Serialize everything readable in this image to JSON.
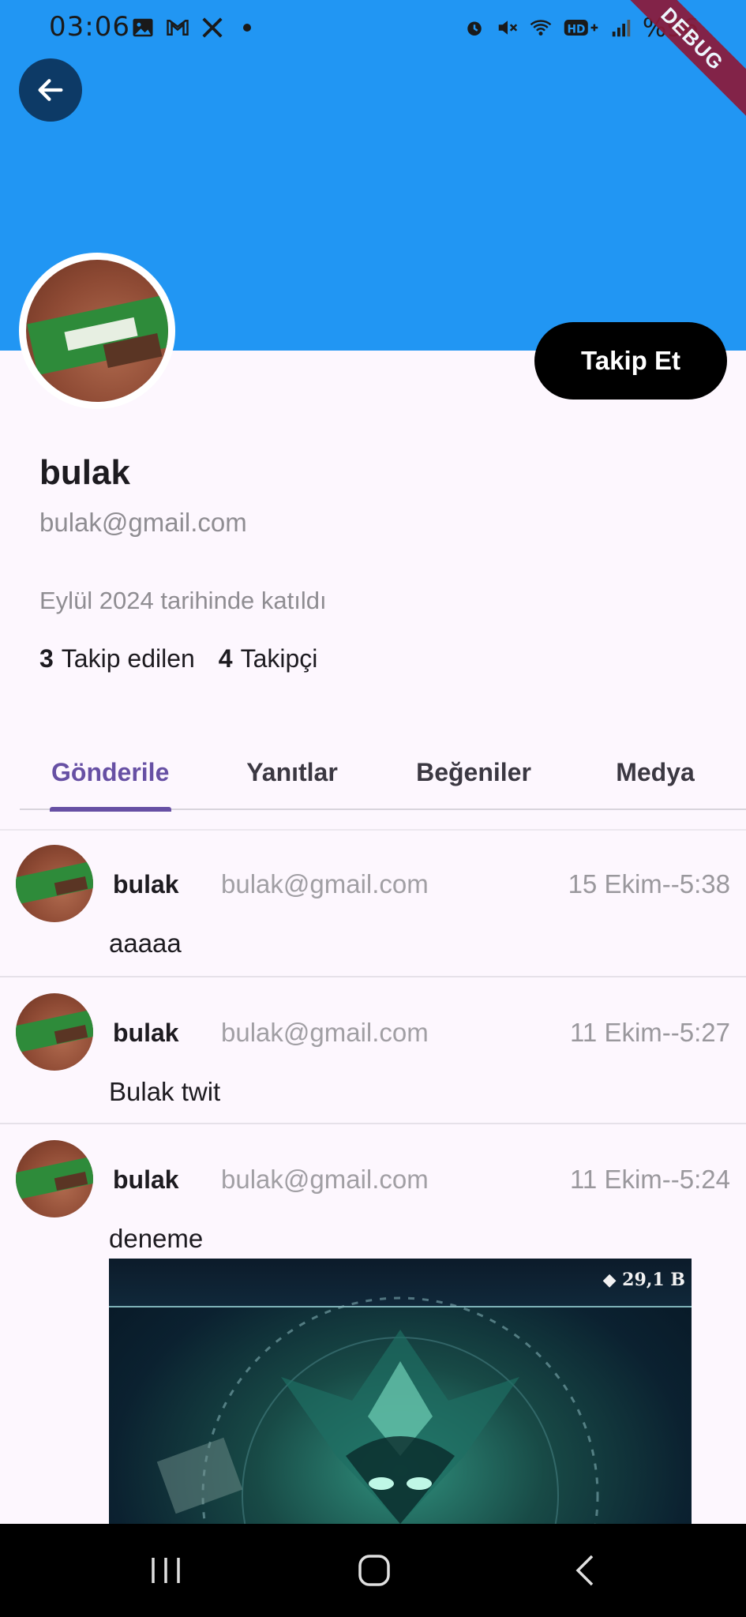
{
  "status_bar": {
    "time": "03:06",
    "left_icons": [
      "gallery-icon",
      "gmail-icon",
      "x-icon",
      "dot-icon"
    ],
    "right_icons": [
      "alarm-icon",
      "mute-icon",
      "wifi-icon",
      "hd-plus-icon",
      "signal-icon"
    ],
    "battery": "%96",
    "debug_banner": "DEBUG"
  },
  "header": {
    "back_label": "back",
    "banner_color": "#2196f3"
  },
  "profile": {
    "name": "bulak",
    "email": "bulak@gmail.com",
    "joined": "Eylül 2024 tarihinde katıldı",
    "following_count": "3",
    "following_label": "Takip edilen",
    "followers_count": "4",
    "followers_label": "Takipçi",
    "follow_button": "Takip Et"
  },
  "tabs": [
    {
      "label": "Gönderiler",
      "active": true
    },
    {
      "label": "Yanıtlar",
      "active": false
    },
    {
      "label": "Beğeniler",
      "active": false
    },
    {
      "label": "Medya",
      "active": false
    }
  ],
  "posts": [
    {
      "name": "bulak",
      "email": "bulak@gmail.com",
      "date": "15 Ekim--5:38",
      "text": "aaaaa"
    },
    {
      "name": "bulak",
      "email": "bulak@gmail.com",
      "date": "11 Ekim--5:27",
      "text": "Bulak twit"
    },
    {
      "name": "bulak",
      "email": "bulak@gmail.com",
      "date": "11 Ekim--5:24",
      "text": "deneme",
      "media_badge": "29,1 B"
    }
  ],
  "colors": {
    "accent": "#6750a4",
    "banner": "#2196f3",
    "follow_button": "#000000"
  }
}
